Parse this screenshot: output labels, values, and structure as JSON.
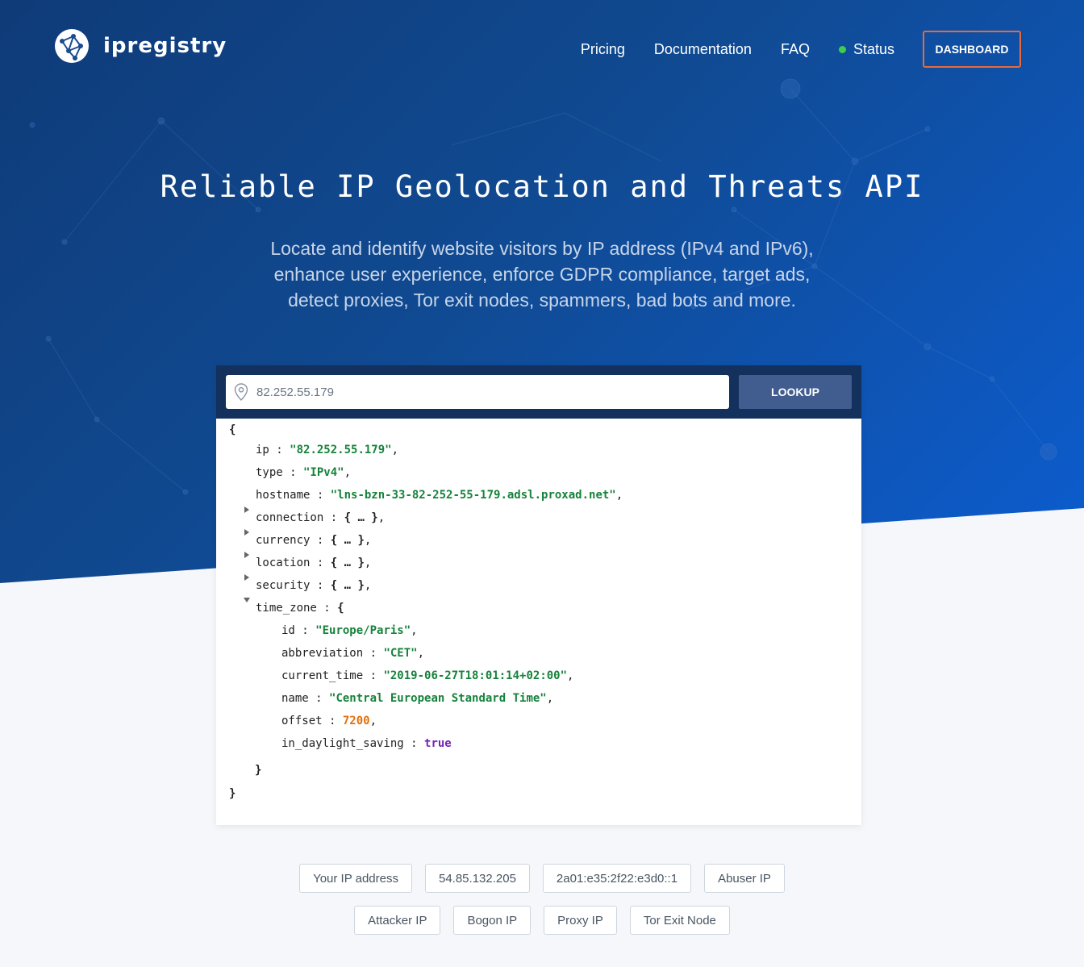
{
  "brand": {
    "name": "ipregistry"
  },
  "nav": {
    "pricing": "Pricing",
    "documentation": "Documentation",
    "faq": "FAQ",
    "status": "Status",
    "dashboard": "DASHBOARD"
  },
  "hero": {
    "title": "Reliable IP Geolocation and Threats API",
    "subtitle_lines": [
      "Locate and identify website visitors by IP address (IPv4 and IPv6),",
      "enhance user experience, enforce GDPR compliance, target ads,",
      "detect proxies, Tor exit nodes, spammers, bad bots and more."
    ]
  },
  "search": {
    "value": "82.252.55.179",
    "button": "LOOKUP"
  },
  "result": {
    "open": "{",
    "close": "}",
    "ip": {
      "key": "ip",
      "value": "\"82.252.55.179\""
    },
    "type": {
      "key": "type",
      "value": "\"IPv4\""
    },
    "hostname": {
      "key": "hostname",
      "value": "\"lns-bzn-33-82-252-55-179.adsl.proxad.net\""
    },
    "collapsed": [
      {
        "key": "connection",
        "value": "{ … }"
      },
      {
        "key": "currency",
        "value": "{ … }"
      },
      {
        "key": "location",
        "value": "{ … }"
      },
      {
        "key": "security",
        "value": "{ … }"
      }
    ],
    "time_zone": {
      "key": "time_zone",
      "open": "{",
      "close": "}",
      "fields": [
        {
          "key": "id",
          "value": "\"Europe/Paris\"",
          "kind": "str"
        },
        {
          "key": "abbreviation",
          "value": "\"CET\"",
          "kind": "str"
        },
        {
          "key": "current_time",
          "value": "\"2019-06-27T18:01:14+02:00\"",
          "kind": "str"
        },
        {
          "key": "name",
          "value": "\"Central European Standard Time\"",
          "kind": "str"
        },
        {
          "key": "offset",
          "value": "7200",
          "kind": "num"
        },
        {
          "key": "in_daylight_saving",
          "value": "true",
          "kind": "bool"
        }
      ]
    }
  },
  "quick_lookups": {
    "row1": [
      "Your IP address",
      "54.85.132.205",
      "2a01:e35:2f22:e3d0::1",
      "Abuser IP"
    ],
    "row2": [
      "Attacker IP",
      "Bogon IP",
      "Proxy IP",
      "Tor Exit Node"
    ]
  },
  "colors": {
    "accent": "#e8693a",
    "status_ok": "#3ecf4a",
    "json_string": "#16823b",
    "json_number": "#e36f0b",
    "json_boolean": "#7425b5"
  }
}
